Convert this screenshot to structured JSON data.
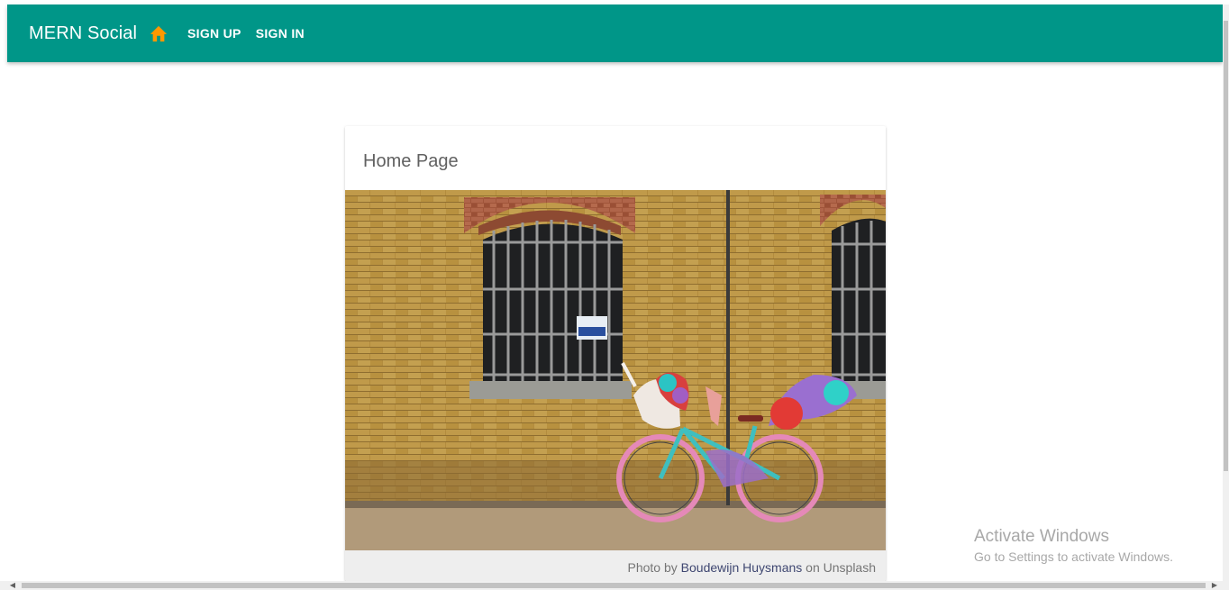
{
  "appbar": {
    "title": "MERN Social",
    "home_icon": "home-icon",
    "home_icon_color": "#ff9800",
    "background": "#009688",
    "nav": [
      {
        "label": "SIGN UP"
      },
      {
        "label": "SIGN IN"
      }
    ]
  },
  "card": {
    "title": "Home Page",
    "image_description_icon": "photo-unicorn-bicycle",
    "caption": {
      "prefix": "Photo by ",
      "author": "Boudewijn Huysmans",
      "suffix": " on Unsplash"
    }
  },
  "watermark": {
    "title": "Activate Windows",
    "subtitle": "Go to Settings to activate Windows."
  }
}
